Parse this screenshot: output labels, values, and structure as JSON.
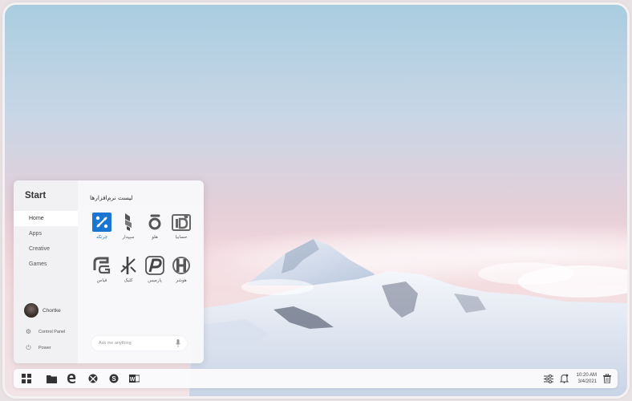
{
  "start_menu": {
    "title": "Start",
    "nav": [
      "Home",
      "Apps",
      "Creative",
      "Games"
    ],
    "active_nav": "Home",
    "user_name": "Chortke",
    "control_panel_label": "Control Panel",
    "power_label": "Power",
    "apps_title": "لیست نرم‌افزارها",
    "apps": [
      {
        "label": "چرتکه",
        "icon": "chortke-icon",
        "active": true
      },
      {
        "label": "سپیدار",
        "icon": "sepidar-icon"
      },
      {
        "label": "هلو",
        "icon": "holoo-icon"
      },
      {
        "label": "حسابیا",
        "icon": "hesabia-icon"
      },
      {
        "label": "قیاس",
        "icon": "ghias-icon"
      },
      {
        "label": "کلیک",
        "icon": "click-icon"
      },
      {
        "label": "پارمیس",
        "icon": "parmis-icon"
      },
      {
        "label": "هوشر",
        "icon": "hooshar-icon"
      }
    ],
    "ask_placeholder": "Ask me anything"
  },
  "taskbar": {
    "icons": [
      "start-icon",
      "folder-icon",
      "edge-icon",
      "xbox-icon",
      "skype-icon",
      "word-icon"
    ],
    "tray_icons": [
      "settings-sliders-icon",
      "notification-bell-icon",
      "trash-icon"
    ],
    "time": "10:20 AM",
    "date": "3/4/2021"
  },
  "colors": {
    "accent": "#1a76d2",
    "app_icon_gray": "#5a5a5a"
  }
}
